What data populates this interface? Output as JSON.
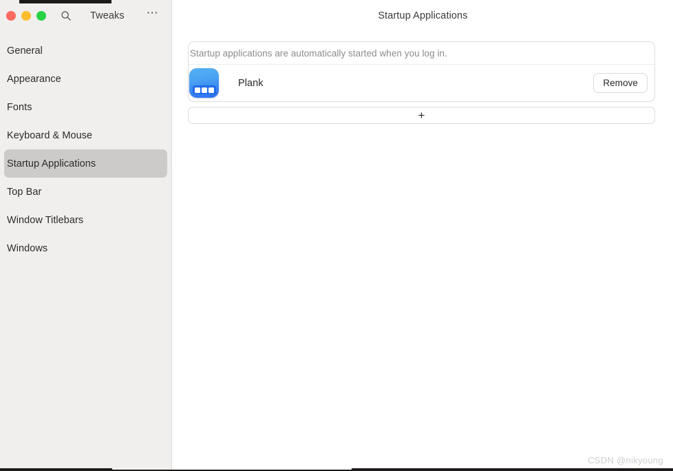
{
  "window": {
    "app_title": "Tweaks",
    "page_title": "Startup Applications",
    "search_icon": "search-icon",
    "menu_icon": "hamburger-menu-icon",
    "traffic_lights": {
      "close_color": "#fb6a5e",
      "minimize_color": "#fdbd2f",
      "maximize_color": "#2ad144"
    }
  },
  "sidebar": {
    "background_color": "#f0efee",
    "selected_color": "#cdcbc9",
    "items": [
      {
        "label": "General",
        "selected": false
      },
      {
        "label": "Appearance",
        "selected": false
      },
      {
        "label": "Fonts",
        "selected": false
      },
      {
        "label": "Keyboard & Mouse",
        "selected": false
      },
      {
        "label": "Startup Applications",
        "selected": true
      },
      {
        "label": "Top Bar",
        "selected": false
      },
      {
        "label": "Window Titlebars",
        "selected": false
      },
      {
        "label": "Windows",
        "selected": false
      }
    ]
  },
  "main": {
    "description": "Startup applications are automatically started when you log in.",
    "apps": [
      {
        "name": "Plank",
        "icon": "plank-dock-icon",
        "icon_color": "#3f8ff2",
        "remove_label": "Remove"
      }
    ],
    "add_button": {
      "icon": "plus-icon",
      "glyph": "+"
    }
  },
  "watermark": {
    "text": "CSDN @nikyoung"
  }
}
